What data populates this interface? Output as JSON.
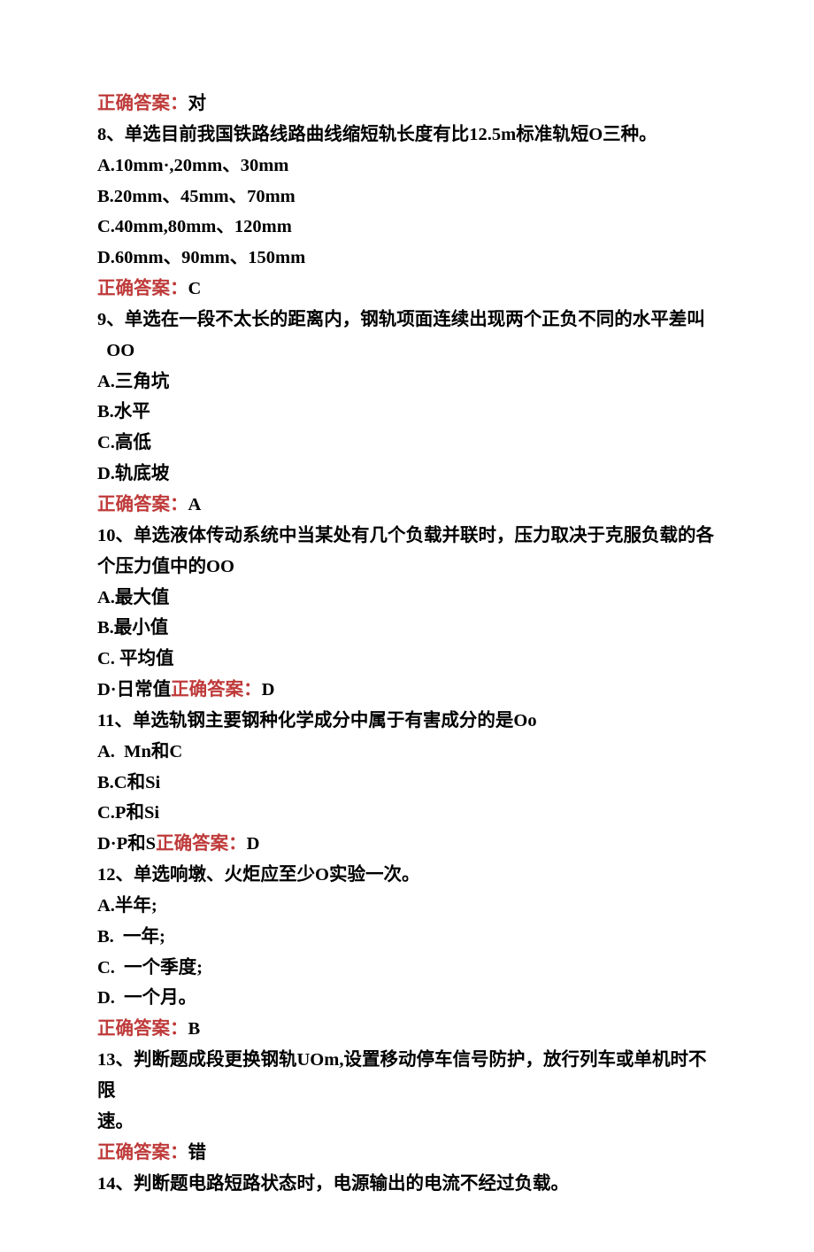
{
  "answer_label": "正确答案：",
  "q7": {
    "answer": "对"
  },
  "q8": {
    "stem": "8、单选目前我国铁路线路曲线缩短轨长度有比12.5m标准轨短O三种。",
    "A": "A.10mm·,20mm、30mm",
    "B": "B.20mm、45mm、70mm",
    "C": "C.40mm,80mm、120mm",
    "D": "D.60mm、90mm、150mm",
    "answer": "C"
  },
  "q9": {
    "stem_line1": "9、单选在一段不太长的距离内，钢轨项面连续出现两个正负不同的水平差叫",
    "stem_line2": "  OO",
    "A": "A.三角坑",
    "B": "B.水平",
    "C": "C.高低",
    "D": "D.轨底坡",
    "answer": "A"
  },
  "q10": {
    "stem_line1": "10、单选液体传动系统中当某处有几个负载并联时，压力取决于克服负载的各",
    "stem_line2": "个压力值中的OO",
    "A": "A.最大值",
    "B": "B.最小值",
    "C": "C. 平均值",
    "D_prefix": "D·日常值",
    "answer": "D"
  },
  "q11": {
    "stem": "11、单选轨钢主要钢种化学成分中属于有害成分的是Oo",
    "A": "A.  Mn和C",
    "B": "B.C和Si",
    "C": "C.P和Si",
    "D_prefix": "D·P和S",
    "answer": "D"
  },
  "q12": {
    "stem": "12、单选响墩、火炬应至少O实验一次。",
    "A": "A.半年;",
    "B": "B.  一年;",
    "C": "C.  一个季度;",
    "D": "D.  一个月。",
    "answer": "B"
  },
  "q13": {
    "stem_line1": "13、判断题成段更换钢轨UOm,设置移动停车信号防护，放行列车或单机时不限",
    "stem_line2": "速。",
    "answer": "错"
  },
  "q14": {
    "stem": "14、判断题电路短路状态时，电源输出的电流不经过负载。"
  }
}
